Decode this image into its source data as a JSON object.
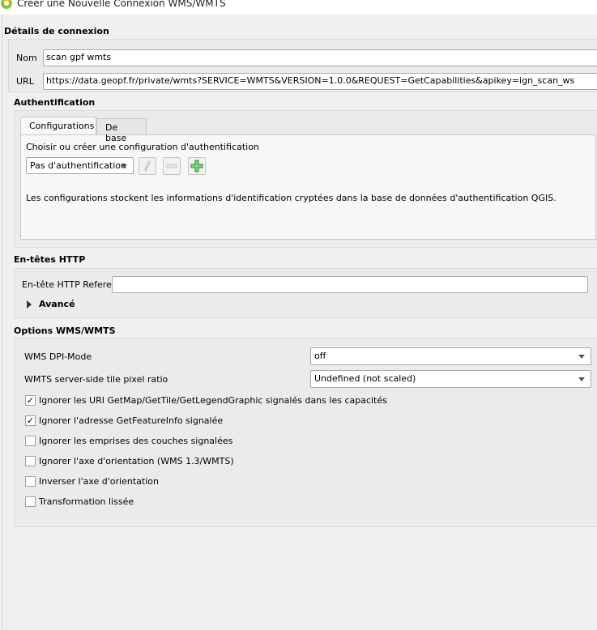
{
  "window": {
    "title": "Créer une Nouvelle Connexion WMS/WMTS"
  },
  "details": {
    "heading": "Détails de connexion",
    "name_label": "Nom",
    "name_value": "scan gpf wmts",
    "url_label": "URL",
    "url_value": "https://data.geopf.fr/private/wmts?SERVICE=WMTS&VERSION=1.0.0&REQUEST=GetCapabilities&apikey=ign_scan_ws"
  },
  "auth": {
    "heading": "Authentification",
    "tabs": [
      {
        "label": "Configurations",
        "active": true
      },
      {
        "label": "De base",
        "active": false
      }
    ],
    "choose_label": "Choisir ou créer une configuration d'authentification",
    "config_value": "Pas d'authentification",
    "info": "Les configurations stockent les informations d'identification cryptées dans la base de données d'authentification QGIS."
  },
  "http": {
    "heading": "En-têtes HTTP",
    "referer_label": "En-tête HTTP Referer",
    "referer_value": "",
    "advanced_label": "Avancé"
  },
  "options": {
    "heading": "Options WMS/WMTS",
    "dpi_label": "WMS DPI-Mode",
    "dpi_value": "off",
    "ratio_label": "WMTS server-side tile pixel ratio",
    "ratio_value": "Undefined (not scaled)",
    "checkboxes": [
      {
        "label": "Ignorer les URI GetMap/GetTile/GetLegendGraphic signalés dans les capacités",
        "checked": true
      },
      {
        "label": "Ignorer l'adresse GetFeatureInfo signalée",
        "checked": true
      },
      {
        "label": "Ignorer les emprises des couches signalées",
        "checked": false
      },
      {
        "label": "Ignorer l'axe d'orientation (WMS 1.3/WMTS)",
        "checked": false
      },
      {
        "label": "Inverser l'axe d'orientation",
        "checked": false
      },
      {
        "label": "Transformation lissée",
        "checked": false
      }
    ]
  }
}
